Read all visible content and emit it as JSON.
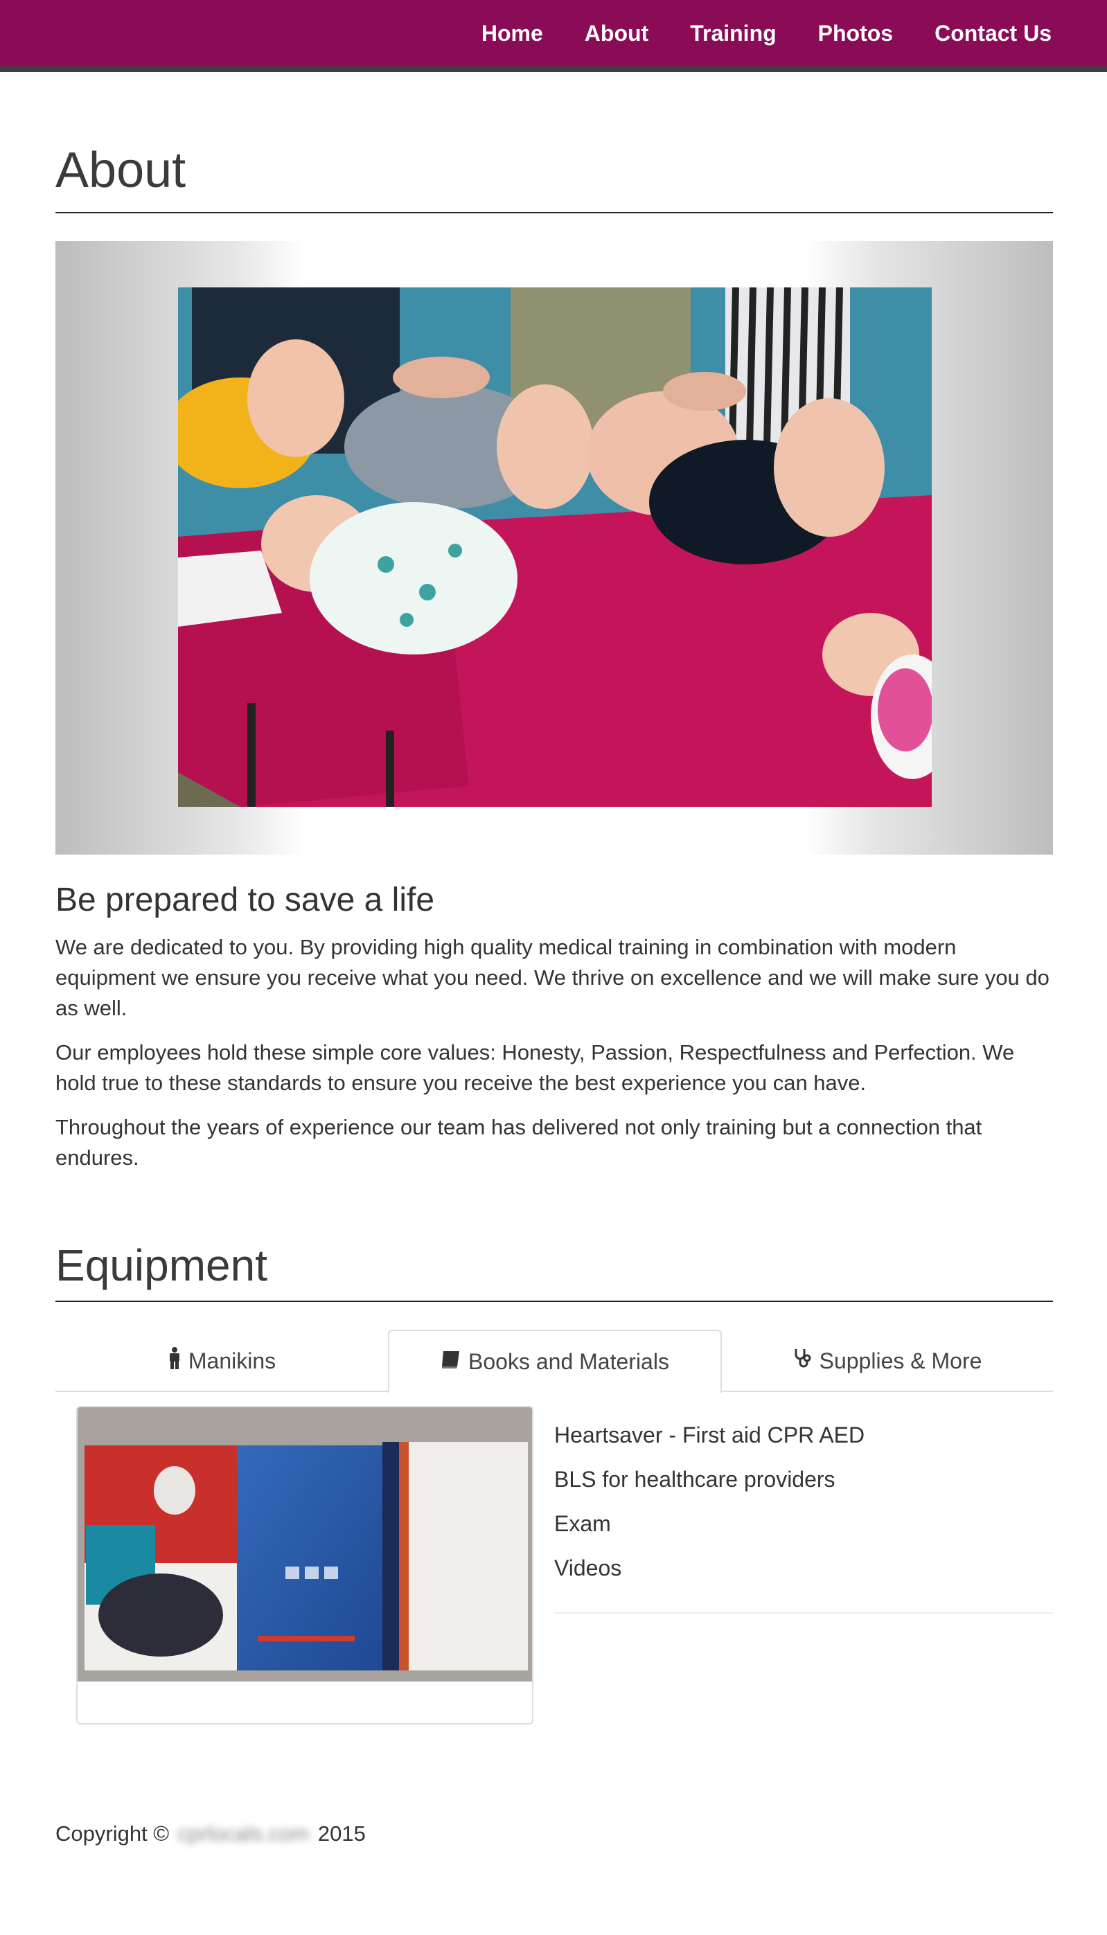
{
  "nav": {
    "items": [
      "Home",
      "About",
      "Training",
      "Photos",
      "Contact Us"
    ]
  },
  "about": {
    "title": "About",
    "subhead": "Be prepared to save a life",
    "paragraphs": [
      "We are dedicated to you. By providing high quality medical training in combination with modern equipment we ensure you receive what you need. We thrive on excellence and we will make sure you do as well.",
      "Our employees hold these simple core values: Honesty, Passion, Respectfulness and Perfection. We hold true to these standards to ensure you receive the best experience you can have.",
      "Throughout the years of experience our team has delivered not only training but a connection that endures."
    ]
  },
  "equipment": {
    "title": "Equipment",
    "tabs": [
      {
        "label": "Manikins",
        "icon": "person-icon"
      },
      {
        "label": "Books and Materials",
        "icon": "book-icon",
        "active": true
      },
      {
        "label": "Supplies & More",
        "icon": "stethoscope-icon"
      }
    ],
    "materials": [
      "Heartsaver - First aid CPR AED",
      "BLS for healthcare providers",
      "Exam",
      "Videos"
    ]
  },
  "footer": {
    "prefix": "Copyright ©",
    "site": "cprlocals.com",
    "year": "2015"
  },
  "colors": {
    "brand": "#8a0c56",
    "nav_border": "#3f3f3f"
  }
}
